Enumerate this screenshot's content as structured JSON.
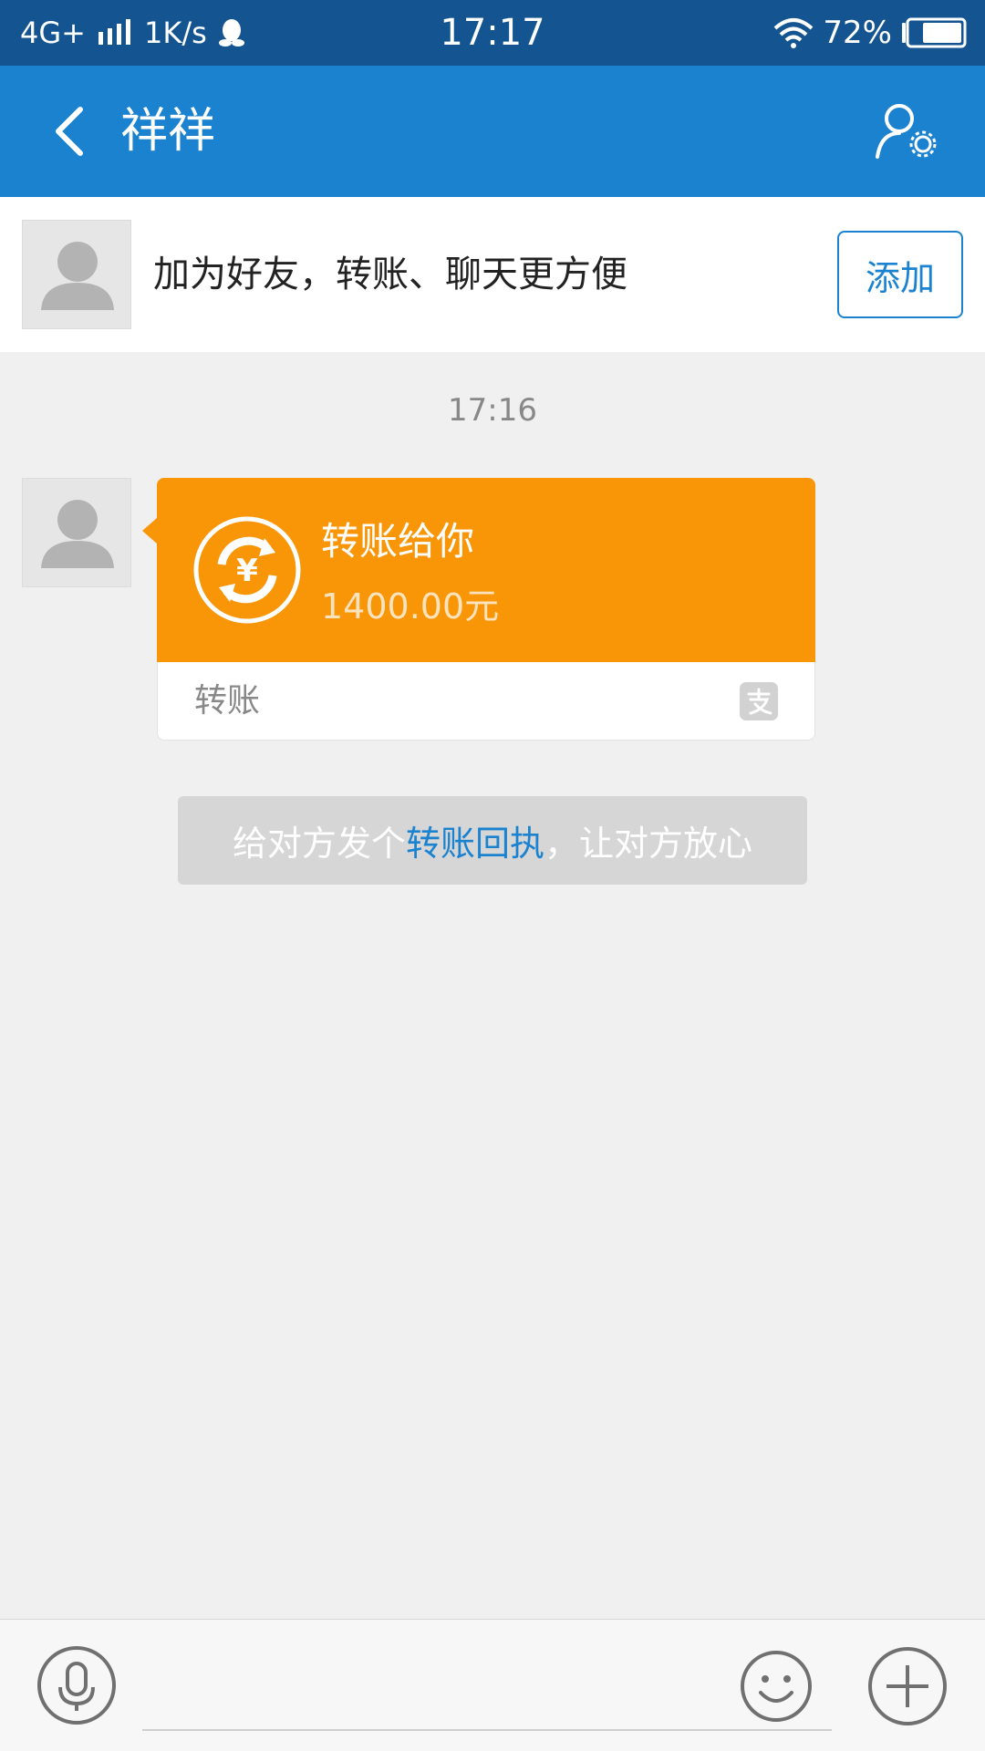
{
  "status_bar": {
    "network": "4G+",
    "speed": "1K/s",
    "time": "17:17",
    "battery": "72%"
  },
  "header": {
    "title": "祥祥"
  },
  "add_friend_banner": {
    "text": "加为好友，转账、聊天更方便",
    "button_label": "添加"
  },
  "chat": {
    "time": "17:16",
    "transfer": {
      "title": "转账给你",
      "amount": "1400.00元",
      "label": "转账"
    },
    "receipt_tip": {
      "prefix": "给对方发个",
      "link": "转账回执",
      "suffix": "，让对方放心"
    }
  },
  "input_bar": {
    "placeholder": ""
  },
  "colors": {
    "status_bar": "#145591",
    "header": "#1b82d0",
    "transfer_card": "#f99608",
    "link": "#1b82d0"
  },
  "icons": [
    "back-icon",
    "profile-settings-icon",
    "transfer-icon",
    "alipay-icon",
    "microphone-icon",
    "emoji-icon",
    "plus-icon"
  ]
}
